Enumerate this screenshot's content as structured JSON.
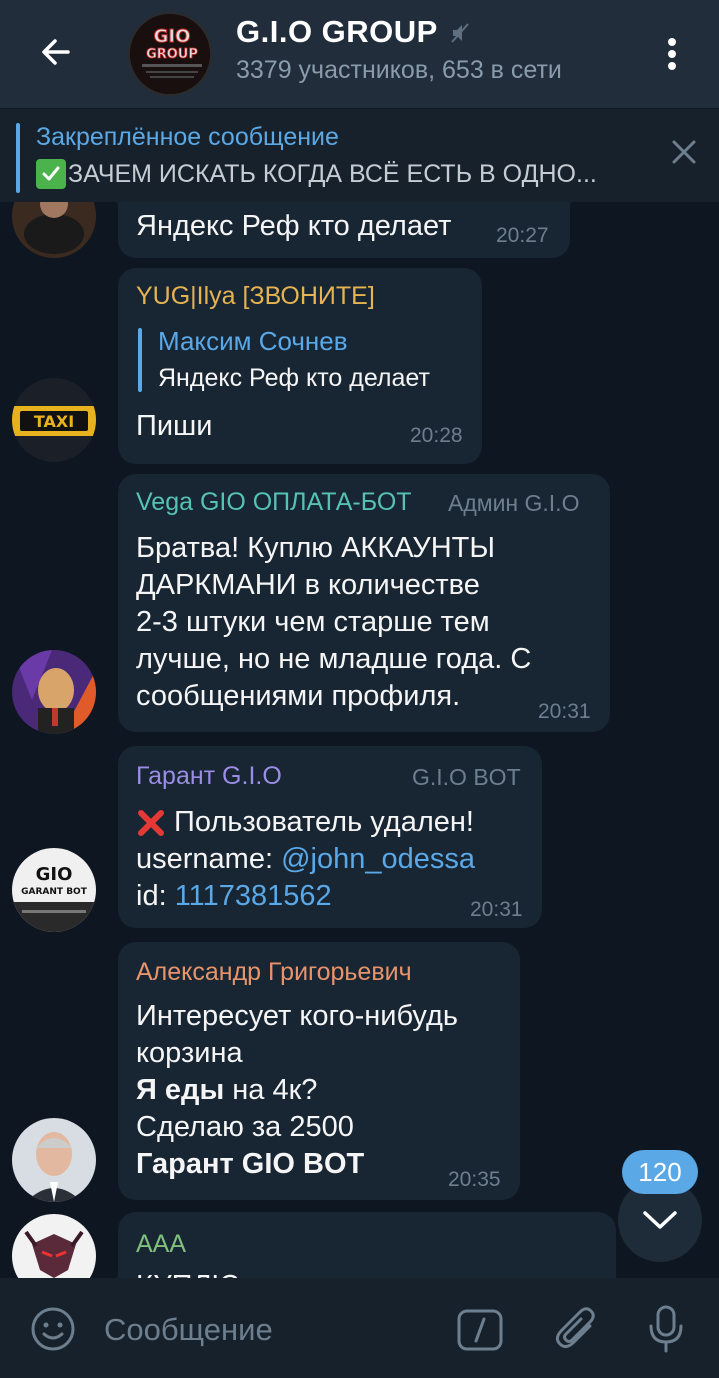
{
  "header": {
    "title": "G.I.O GROUP",
    "subtitle": "3379 участников, 653 в сети",
    "avatar_text_top": "GIO",
    "avatar_text_bottom": "GROUP"
  },
  "pinned": {
    "label": "Закреплённое сообщение",
    "text": "ЗАЧЕМ ИСКАТЬ КОГДА ВСЁ ЕСТЬ В ОДНО..."
  },
  "messages": [
    {
      "text": "Яндекс Реф кто делает",
      "time": "20:27"
    },
    {
      "sender": "YUG|Ilya [ЗВОНИТЕ]",
      "quote_author": "Максим Сочнев",
      "quote_text": "Яндекс Реф кто делает",
      "text": "Пиши",
      "time": "20:28",
      "avatar_label": "TAXI"
    },
    {
      "sender": "Vega GIO ОПЛАТА-БОТ",
      "role": "Админ G.I.O",
      "lines": [
        "Братва! Куплю АККАУНТЫ",
        "ДАРКМАНИ в количестве",
        "2-3 штуки чем старше тем",
        "лучше, но не младше года. С",
        "сообщениями профиля."
      ],
      "time": "20:31"
    },
    {
      "sender": "Гарант G.I.O",
      "role": "G.I.O BOT",
      "line1": "Пользователь удален!",
      "line2_label": "username: ",
      "line2_link": "@john_odessa",
      "line3_label": "id: ",
      "line3_link": "1117381562",
      "time": "20:31",
      "avatar_text_top": "GIO",
      "avatar_text_bottom": "GARANT BOT"
    },
    {
      "sender": "Александр Григорьевич",
      "line1": "Интересует кого-нибудь",
      "line2": "корзина",
      "line3_bold": "Я еды",
      "line3_rest": " на 4к?",
      "line4": "Сделаю за 2500",
      "line5_bold": "Гарант GIO BOT",
      "time": "20:35"
    },
    {
      "sender": "AAA",
      "text": "КУПЛЮ"
    }
  ],
  "unread_count": "120",
  "input": {
    "placeholder": "Сообщение"
  },
  "colors": {
    "background": "#0e1621",
    "header": "#212d3b",
    "bubble": "#182533",
    "accent": "#5aa8e6",
    "sender_yellow": "#e5b451",
    "sender_teal": "#55c2b3",
    "sender_purple": "#9b8ce6",
    "sender_orange": "#e8946b",
    "sender_green": "#7fc07b",
    "delete_red": "#e53935"
  }
}
